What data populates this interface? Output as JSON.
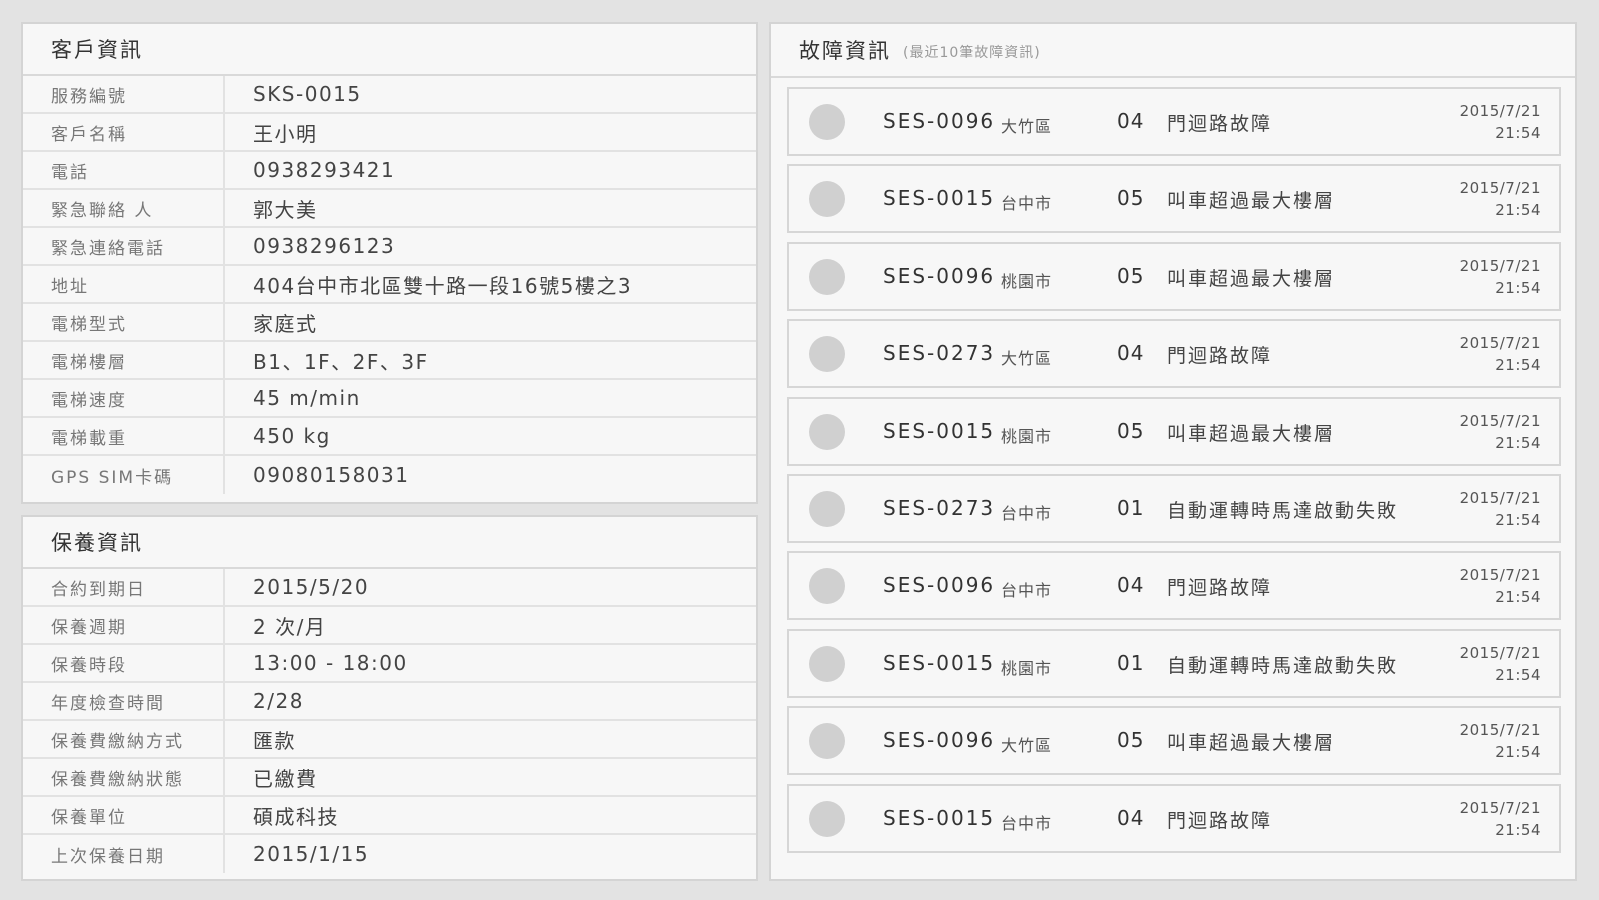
{
  "customer": {
    "title": "客戶資訊",
    "rows": [
      {
        "label": "服務編號",
        "value": "SKS-0015"
      },
      {
        "label": "客戶名稱",
        "value": "王小明"
      },
      {
        "label": "電話",
        "value": "0938293421"
      },
      {
        "label": "緊急聯絡 人",
        "value": "郭大美"
      },
      {
        "label": "緊急連絡電話",
        "value": "0938296123"
      },
      {
        "label": "地址",
        "value": "404台中市北區雙十路一段16號5樓之3"
      },
      {
        "label": "電梯型式",
        "value": "家庭式"
      },
      {
        "label": "電梯樓層",
        "value": "B1、1F、2F、3F"
      },
      {
        "label": "電梯速度",
        "value": "45 m/min"
      },
      {
        "label": "電梯載重",
        "value": "450 kg"
      },
      {
        "label": "GPS SIM卡碼",
        "value": "09080158031"
      }
    ]
  },
  "maintenance": {
    "title": "保養資訊",
    "rows": [
      {
        "label": "合約到期日",
        "value": "2015/5/20"
      },
      {
        "label": "保養週期",
        "value": "2 次/月"
      },
      {
        "label": "保養時段",
        "value": "13:00 - 18:00"
      },
      {
        "label": "年度檢查時間",
        "value": "2/28"
      },
      {
        "label": "保養費繳納方式",
        "value": "匯款"
      },
      {
        "label": "保養費繳納狀態",
        "value": "已繳費"
      },
      {
        "label": "保養單位",
        "value": "碩成科技"
      },
      {
        "label": "上次保養日期",
        "value": "2015/1/15"
      }
    ]
  },
  "faults": {
    "title": "故障資訊",
    "subtitle": "(最近10筆故障資訊)",
    "items": [
      {
        "code": "SES-0096",
        "area": "大竹區",
        "num": "04",
        "desc": "門迴路故障",
        "date": "2015/7/21",
        "time": "21:54"
      },
      {
        "code": "SES-0015",
        "area": "台中市",
        "num": "05",
        "desc": "叫車超過最大樓層",
        "date": "2015/7/21",
        "time": "21:54"
      },
      {
        "code": "SES-0096",
        "area": "桃園市",
        "num": "05",
        "desc": "叫車超過最大樓層",
        "date": "2015/7/21",
        "time": "21:54"
      },
      {
        "code": "SES-0273",
        "area": "大竹區",
        "num": "04",
        "desc": "門迴路故障",
        "date": "2015/7/21",
        "time": "21:54"
      },
      {
        "code": "SES-0015",
        "area": "桃園市",
        "num": "05",
        "desc": "叫車超過最大樓層",
        "date": "2015/7/21",
        "time": "21:54"
      },
      {
        "code": "SES-0273",
        "area": "台中市",
        "num": "01",
        "desc": "自動運轉時馬達啟動失敗",
        "date": "2015/7/21",
        "time": "21:54"
      },
      {
        "code": "SES-0096",
        "area": "台中市",
        "num": "04",
        "desc": "門迴路故障",
        "date": "2015/7/21",
        "time": "21:54"
      },
      {
        "code": "SES-0015",
        "area": "桃園市",
        "num": "01",
        "desc": "自動運轉時馬達啟動失敗",
        "date": "2015/7/21",
        "time": "21:54"
      },
      {
        "code": "SES-0096",
        "area": "大竹區",
        "num": "05",
        "desc": "叫車超過最大樓層",
        "date": "2015/7/21",
        "time": "21:54"
      },
      {
        "code": "SES-0015",
        "area": "台中市",
        "num": "04",
        "desc": "門迴路故障",
        "date": "2015/7/21",
        "time": "21:54"
      }
    ]
  }
}
